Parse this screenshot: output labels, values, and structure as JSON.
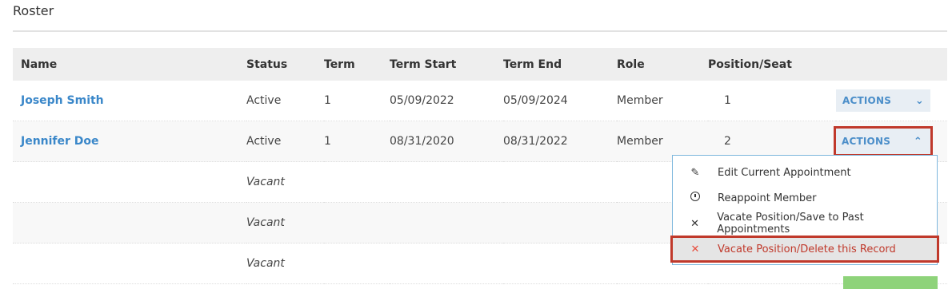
{
  "page": {
    "title": "Roster"
  },
  "table": {
    "headers": [
      "Name",
      "Status",
      "Term",
      "Term Start",
      "Term End",
      "Role",
      "Position/Seat",
      ""
    ],
    "rows": [
      {
        "name": "Joseph Smith",
        "status": "Active",
        "term": "1",
        "term_start": "05/09/2022",
        "term_end": "05/09/2024",
        "role": "Member",
        "seat": "1",
        "action": "ACTIONS"
      },
      {
        "name": "Jennifer Doe",
        "status": "Active",
        "term": "1",
        "term_start": "08/31/2020",
        "term_end": "08/31/2022",
        "role": "Member",
        "seat": "2",
        "action": "ACTIONS"
      },
      {
        "status": "Vacant"
      },
      {
        "status": "Vacant"
      },
      {
        "status": "Vacant"
      }
    ]
  },
  "dropdown": {
    "items": [
      {
        "label": "Edit Current Appointment",
        "icon": "edit-icon"
      },
      {
        "label": "Reappoint Member",
        "icon": "clock-icon"
      },
      {
        "label": "Vacate Position/Save to Past Appointments",
        "icon": "close-icon"
      },
      {
        "label": "Vacate Position/Delete this Record",
        "icon": "close-icon"
      }
    ]
  },
  "colors": {
    "link": "#3a87c9",
    "highlight": "#c0392b",
    "header_bg": "#eeeeee",
    "action_bg": "#e8eef4"
  }
}
